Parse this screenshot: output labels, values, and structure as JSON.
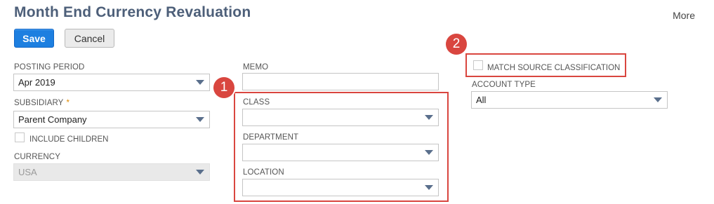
{
  "page": {
    "title": "Month End Currency Revaluation",
    "more_label": "More"
  },
  "toolbar": {
    "save_label": "Save",
    "cancel_label": "Cancel"
  },
  "form": {
    "posting_period": {
      "label": "POSTING PERIOD",
      "value": "Apr 2019"
    },
    "subsidiary": {
      "label": "SUBSIDIARY",
      "required_mark": "*",
      "value": "Parent Company"
    },
    "include_children": {
      "label": "INCLUDE CHILDREN",
      "checked": false
    },
    "currency": {
      "label": "CURRENCY",
      "value": "USA",
      "disabled": true
    },
    "memo": {
      "label": "MEMO",
      "value": ""
    },
    "class": {
      "label": "CLASS",
      "value": ""
    },
    "department": {
      "label": "DEPARTMENT",
      "value": ""
    },
    "location": {
      "label": "LOCATION",
      "value": ""
    },
    "match_source_classification": {
      "label": "MATCH SOURCE CLASSIFICATION",
      "checked": false
    },
    "account_type": {
      "label": "ACCOUNT TYPE",
      "value": "All"
    }
  },
  "annotations": [
    {
      "number": "1"
    },
    {
      "number": "2"
    }
  ],
  "colors": {
    "title": "#4d5f79",
    "save_button": "#1d7fe0",
    "highlight": "#d9463f",
    "required": "#e08a00"
  }
}
